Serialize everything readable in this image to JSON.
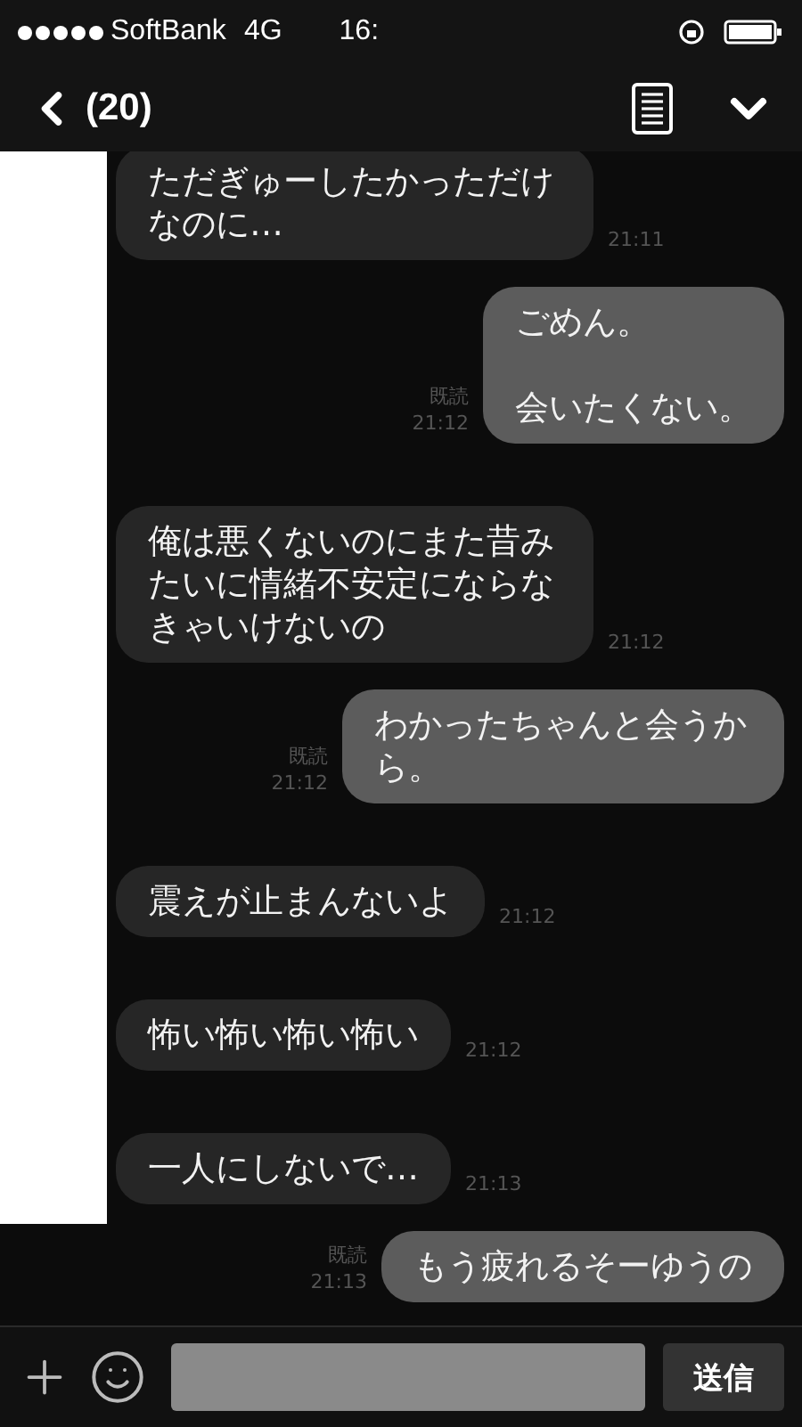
{
  "status_bar": {
    "carrier": "SoftBank",
    "network": "4G",
    "time": "16:"
  },
  "header": {
    "unread_count": "(20)"
  },
  "messages": [
    {
      "kind": "incoming",
      "text": "ただぎゅーしたかっただけなのに…",
      "time": "21:11"
    },
    {
      "kind": "outgoing",
      "paragraphs": [
        "ごめん。",
        "会いたくない。"
      ],
      "read": "既読",
      "time": "21:12"
    },
    {
      "kind": "incoming",
      "text": "俺は悪くないのにまた昔みたいに情緒不安定にならなきゃいけないの",
      "time": "21:12"
    },
    {
      "kind": "outgoing",
      "text": "わかったちゃんと会うから。",
      "read": "既読",
      "time": "21:12"
    },
    {
      "kind": "incoming",
      "text": "震えが止まんないよ",
      "time": "21:12"
    },
    {
      "kind": "incoming",
      "text": "怖い怖い怖い怖い",
      "time": "21:12"
    },
    {
      "kind": "incoming",
      "text": "一人にしないで…",
      "time": "21:13"
    },
    {
      "kind": "outgoing",
      "text": "もう疲れるそーゆうの",
      "read": "既読",
      "time": "21:13"
    }
  ],
  "composer": {
    "send_label": "送信"
  }
}
